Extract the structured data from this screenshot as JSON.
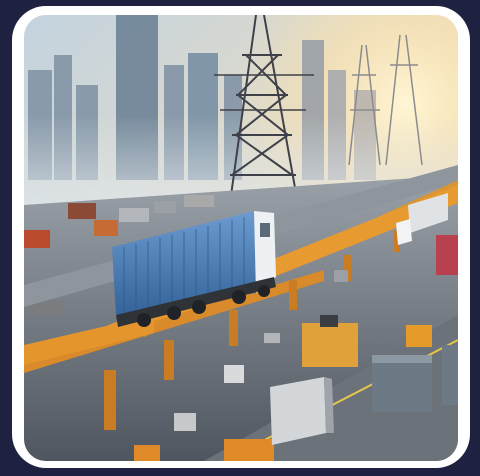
{
  "image": {
    "subject": "illustration",
    "palette": {
      "frame_background": "#1e2140",
      "card": "#ffffff",
      "sky_top": "#c9d6e0",
      "sky_horizon": "#f6d7a6",
      "sun": "#fff2c8",
      "city": "#7f93a6",
      "pylon": "#4b4b55",
      "road": "#5f666f",
      "rail_orange": "#e2922c",
      "container_blue": "#4c7fb8",
      "cab_white": "#eef1f4"
    }
  }
}
